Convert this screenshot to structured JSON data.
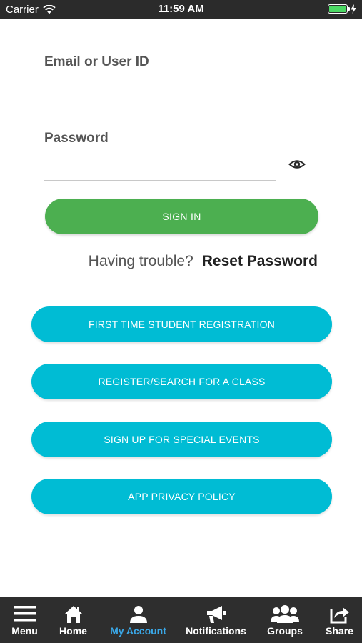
{
  "status_bar": {
    "carrier": "Carrier",
    "time": "11:59 AM",
    "battery_level": 1.0,
    "battery_color": "#4cd964"
  },
  "login": {
    "email_label": "Email or User ID",
    "email_value": "",
    "password_label": "Password",
    "password_value": "",
    "signin_label": "SIGN IN",
    "trouble_text": "Having trouble?",
    "reset_label": "Reset Password"
  },
  "actions": [
    {
      "label": "FIRST TIME STUDENT REGISTRATION"
    },
    {
      "label": "REGISTER/SEARCH FOR A CLASS"
    },
    {
      "label": "SIGN UP FOR SPECIAL EVENTS"
    },
    {
      "label": "APP PRIVACY POLICY"
    }
  ],
  "tabbar": {
    "items": [
      {
        "label": "Menu",
        "icon": "menu-icon"
      },
      {
        "label": "Home",
        "icon": "home-icon"
      },
      {
        "label": "My Account",
        "icon": "user-icon",
        "active": true
      },
      {
        "label": "Notifications",
        "icon": "megaphone-icon"
      },
      {
        "label": "Groups",
        "icon": "group-icon"
      },
      {
        "label": "Share",
        "icon": "share-icon"
      }
    ]
  },
  "colors": {
    "signin": "#4caf50",
    "action": "#00bcd4",
    "tab_active": "#3aa8e8",
    "tabbar_bg": "#2e2e2e"
  }
}
